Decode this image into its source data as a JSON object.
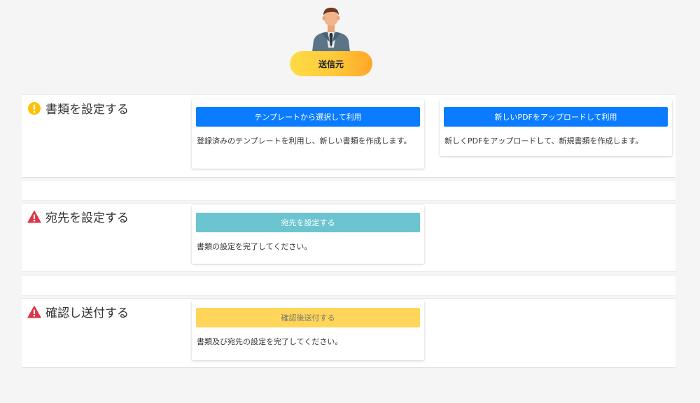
{
  "sender": {
    "avatar_icon": "businessman-avatar-icon",
    "label": "送信元"
  },
  "sections": {
    "document": {
      "status_icon": "exclamation-circle-icon",
      "status_color": "#ffc107",
      "title": "書類を設定する",
      "template_card": {
        "button_label": "テンプレートから選択して利用",
        "description": "登録済みのテンプレートを利用し、新しい書類を作成します。"
      },
      "upload_card": {
        "button_label": "新しいPDFをアップロードして利用",
        "description": "新しくPDFをアップロードして、新規書類を作成します。"
      }
    },
    "recipient": {
      "status_icon": "warning-triangle-icon",
      "status_color": "#dc3545",
      "title": "宛先を設定する",
      "card": {
        "button_label": "宛先を設定する",
        "description": "書類の設定を完了してください。"
      }
    },
    "confirm": {
      "status_icon": "warning-triangle-icon",
      "status_color": "#dc3545",
      "title": "確認し送付する",
      "card": {
        "button_label": "確認後送付する",
        "description": "書類及び宛先の設定を完了してください。"
      }
    }
  },
  "colors": {
    "primary_button": "#0b7cff",
    "recipient_button": "#6cc4d0",
    "confirm_button": "#ffd659",
    "badge_gradient_start": "#ffdc46",
    "badge_gradient_end": "#ffa727"
  }
}
